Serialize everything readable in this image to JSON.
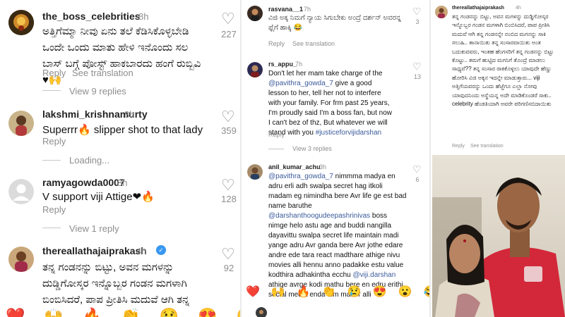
{
  "panel1": {
    "comments": [
      {
        "username": "the_boss_celebrities",
        "time": "8h",
        "text": "ಅತ್ತಿಗೆಮ್ಮಾ ನೀವು ಏನು ತಲೆ ಕೆಡಿಸಿಕೊಳ್ಳಬೇಡಿ ಒಂದೇ ಒಂದು ಮಾತು ಹೇಳಿ ಇನೊಂದು ಸಲ ಬಾಸ್ ಬಗ್ಗೆ ಪೋಸ್ಟ್ ಹಾಕಬಾರದು ಹಂಗೆ ರುಬ್ಬಿವಿ ♥🙌",
        "reply_label": "Reply",
        "translation_label": "See translation",
        "likes": "227",
        "view_replies": "View 9 replies"
      },
      {
        "username": "lakshmi_krishnamurty",
        "time": "8h",
        "text": "Superrr🔥 slipper shot to that lady",
        "reply_label": "Reply",
        "likes": "359",
        "view_replies": "Loading..."
      },
      {
        "username": "ramyagowda0007",
        "time": "8h",
        "text": "V support viji Attige❤🔥",
        "reply_label": "Reply",
        "likes": "128",
        "view_replies": "View 1 reply"
      },
      {
        "username": "thereallathajaiprakash",
        "time": "4h",
        "text": "ತನ್ನ ಗಂಡನನ್ನು ಬಿಟ್ಟು, ಅವನ ಮಗಳನ್ನು ದುಡ್ಡಿಗೋಸ್ಕರ ಇನ್ನೊಬ್ಬರ ಗಂಡನ ಮಗಳಾಗಿ ಬಿಂಬಿಸಿದರೆ, ಪಾಪ ಪ್ರೀತಿಸಿ ಮದುವೆ ಆಗಿ ತನ್ನ",
        "likes": "92"
      }
    ],
    "emojis": [
      "❤️",
      "🙌",
      "🔥",
      "👏",
      "😢",
      "😍",
      "😮",
      "😂"
    ]
  },
  "panel2": {
    "comments": [
      {
        "username": "rasvana__1",
        "time": "7h",
        "text": "ವಿಜಿ ಅಕ್ಕ ನಿಮಗೆ ನ್ಯಾಯ ಸಿಗುಬೇಕು ಅಂದ್ರೆ ದರ್ಶನ್ ಅವರನ್ನ ಫ್ಲೆಗೆ ಹಾಕ್ಕಿ 😂",
        "reply_label": "Reply",
        "translation_label": "See translation",
        "likes": "3"
      },
      {
        "username": "rs_appu_",
        "time": "7h",
        "text_parts": [
          "Don't let her mam take charge of the ",
          "@pavithra_gowda_7",
          " give a good lesson to her, tell her not to interfere with your family. For frm past 25 years, I'm proudly said I'm a boss fan, but now I can't bez of thz, But whatever we will stand with you ",
          "#justiceforvijidarshan"
        ],
        "reply_label": "Reply",
        "likes": "13",
        "view_replies": "View 3 replies"
      },
      {
        "username": "anil_kumar_achu",
        "time": "3h",
        "text_parts": [
          "@pavithra_gowda_7",
          " nimmma madya en adru erli adh swalpa secret hag itkoli madam eg nimindha bere Avr life ge est bad name baruthe ",
          "@darshanthoogudeepashrinivas",
          " boss nimge helo astu age and buddi nangilla dayavittu swalpa secret life maintain madi yange adru Avr ganda bere Avr jothe edare andre ede tara react madthare athige nivu movies alli hennu anno padakke estu value kodthira adhakintha ecchu ",
          "@viji.darshan",
          " athige avrge kodi mathu bere en edru erithi social media enda nim matter alli"
        ],
        "likes": "6"
      }
    ],
    "emojis": [
      "❤️",
      "🙌",
      "🔥",
      "👏",
      "😢",
      "😍",
      "😮",
      "😂"
    ]
  },
  "panel3": {
    "username": "thereallathajaiprakash",
    "time": "4h",
    "text": "ತನ್ನ ಗಂಡನನ್ನು ಬಿಟ್ಟು, ಅವನ ಮಗಳನ್ನು ದುಡ್ಡಿಗೋಸ್ಕರ ಇನ್ನೊಬ್ಬರ ಗಂಡನ ಮಗಳಾಗಿ ಬಿಂಬಿಸಿದರೆ, ಪಾಪ ಪ್ರೀತಿಸಿ ಮದುವೆ ಆಗಿ ತನ್ನ ಗಂಡನನ್ನೇ ನಂಬಿದ ಮಗನನ್ನು ಸಾಕಿ ಸಲುಹಿ.. ತಾನಾಯಿತು ತನ್ನ ಸಂಸಾರವಾಯಿತು ಅಂತ ಬದುಕುವವರು, ಇಂತಹ ಹೆಂಗಸರಿಗೆ ತನ್ನ ಗಂಡನನ್ನು ಬಿಟ್ಟು ಕೊಟ್ಟು.. ತಮಗೆ ಹುಟ್ಟಿದ ಮಗನಿಗೆ ತೊಂದ್ರೆ ಮಾಡಲು ಸಾಧ್ಯವೆ?? ತನ್ನ ಸಂಸಾರ ರಾಕಿಕೊಳ್ಳಲು ಯಾವುದೇ ಹೆಣ್ಣು ಹೋರಿಸಿ ವಿಜಿ ಅಕ್ಕನ ಇದನ್ನೇ ಮಾಡುತ್ತಾರು... viji ಅತ್ತಿಗೆಯವರನ್ನು ಒಂದು ಹೆಜ್ಜೆಗೂ ಎಲ್ಲಾ ನೋವು ಯಾವುದನಿಂದು ಅಸ್ಥೆಯನ್ನ ಅದೇ ಮಾಡಿಕೊಂಡರೆ ಸಾಕು.. celebrity ಹೆಂಡತಿಯಾಗಿ ಅವರೇ ಪರಿಗಣಿಸಬಿದಾಯಿತು",
    "reply_label": "Reply",
    "translation_label": "See translation"
  }
}
